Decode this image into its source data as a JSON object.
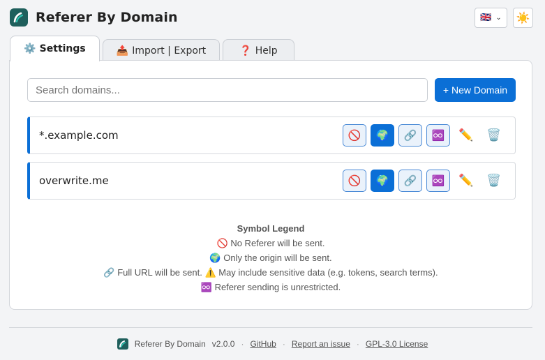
{
  "header": {
    "title": "Referer By Domain",
    "language_flag": "🇬🇧",
    "language_icon": "uk-flag-icon",
    "theme_icon_glyph": "☀️"
  },
  "tabs": [
    {
      "icon": "⚙️",
      "label": "Settings",
      "active": true
    },
    {
      "icon": "📤",
      "label": "Import | Export",
      "active": false
    },
    {
      "icon": "❓",
      "label": "Help",
      "active": false
    }
  ],
  "search": {
    "placeholder": "Search domains...",
    "value": ""
  },
  "new_domain_label": "+ New Domain",
  "domains": [
    {
      "name": "*.example.com",
      "active_mode": "origin"
    },
    {
      "name": "overwrite.me",
      "active_mode": "origin"
    }
  ],
  "mode_glyphs": {
    "no_referer": "🚫",
    "origin": "🌍",
    "full_url": "🔗",
    "unrestricted": "♾️",
    "edit": "✏️",
    "delete": "🗑️"
  },
  "legend": {
    "title": "Symbol Legend",
    "lines": [
      "🚫 No Referer will be sent.",
      "🌍 Only the origin will be sent.",
      "🔗 Full URL will be sent. ⚠️ May include sensitive data (e.g. tokens, search terms).",
      "♾️ Referer sending is unrestricted."
    ]
  },
  "footer": {
    "app_name": "Referer By Domain",
    "version": "v2.0.0",
    "github": "GitHub",
    "report": "Report an issue",
    "license": "GPL-3.0 License"
  },
  "colors": {
    "accent": "#0b6fd6",
    "logo_bg": "#1f5f5c"
  }
}
